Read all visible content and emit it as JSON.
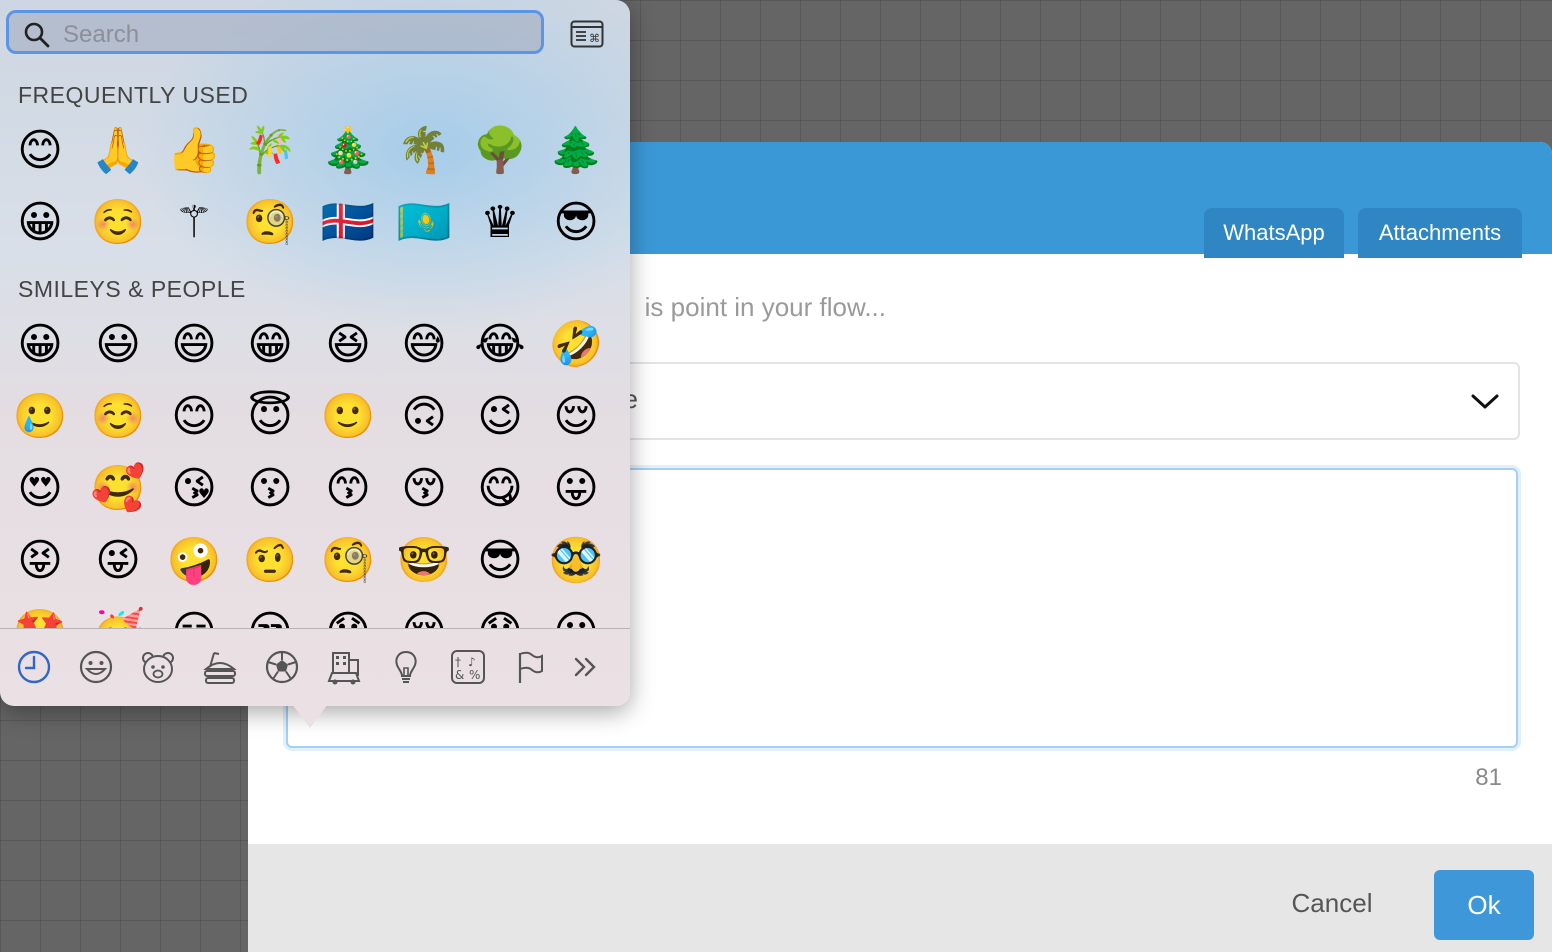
{
  "dialog": {
    "tabs": [
      {
        "label": "WhatsApp"
      },
      {
        "label": "Attachments"
      }
    ],
    "instruction_visible": "is point in your flow...",
    "select_value_visible": "e",
    "char_counter": "81",
    "cancel_label": "Cancel",
    "ok_label": "Ok",
    "header_color": "#3b98d6"
  },
  "picker": {
    "search_placeholder": "Search",
    "sections": [
      {
        "title": "FREQUENTLY USED",
        "emojis": [
          "😊",
          "🙏",
          "👍",
          "🎋",
          "🎄",
          "🌴",
          "🌳",
          "🌲",
          "😀",
          "☺️",
          "⚚",
          "🧐",
          "🇮🇸",
          "🇰🇿",
          "♛",
          "😎"
        ]
      },
      {
        "title": "SMILEYS & PEOPLE",
        "emojis": [
          "😀",
          "😃",
          "😄",
          "😁",
          "😆",
          "😅",
          "😂",
          "🤣",
          "🥲",
          "☺️",
          "😊",
          "😇",
          "🙂",
          "🙃",
          "😉",
          "😌",
          "😍",
          "🥰",
          "😘",
          "😗",
          "😙",
          "😚",
          "😋",
          "😛",
          "😝",
          "😜",
          "🤪",
          "🤨",
          "🧐",
          "🤓",
          "😎",
          "🥸",
          "🤩",
          "🥳",
          "😏",
          "😒",
          "😞",
          "😔",
          "😟",
          "😕"
        ]
      }
    ],
    "categories": [
      {
        "name": "frequently-used",
        "icon": "clock-icon",
        "active": true
      },
      {
        "name": "smileys-people",
        "icon": "smiley-icon"
      },
      {
        "name": "animals-nature",
        "icon": "bear-icon"
      },
      {
        "name": "food-drink",
        "icon": "food-icon"
      },
      {
        "name": "activity",
        "icon": "soccer-ball-icon"
      },
      {
        "name": "travel-places",
        "icon": "buildings-car-icon"
      },
      {
        "name": "objects",
        "icon": "lightbulb-icon"
      },
      {
        "name": "symbols",
        "icon": "symbols-icon"
      },
      {
        "name": "flags",
        "icon": "flag-icon"
      },
      {
        "name": "more",
        "icon": "double-chevron-right-icon"
      }
    ],
    "accent_color": "#2f66c8"
  }
}
